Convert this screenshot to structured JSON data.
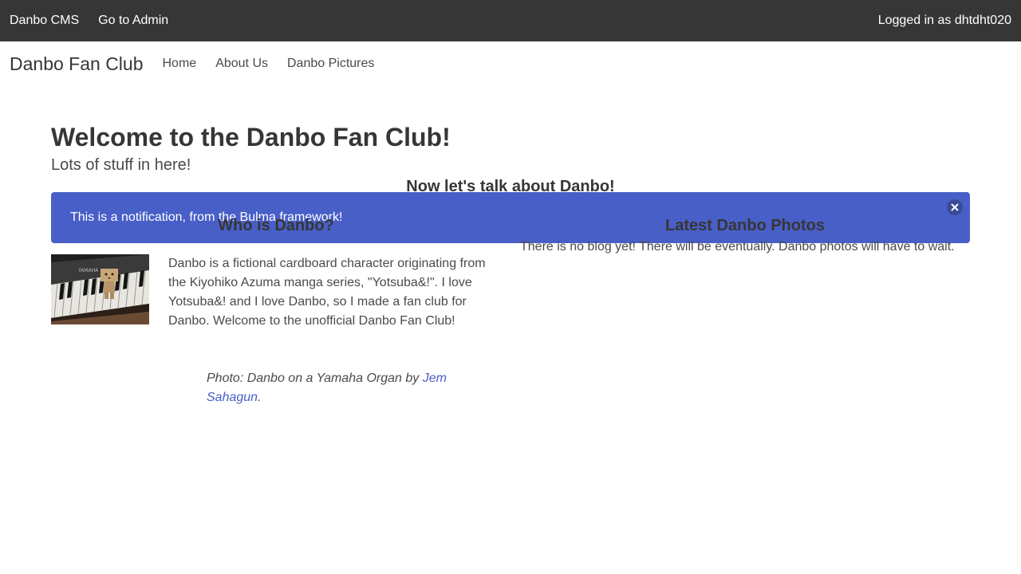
{
  "adminbar": {
    "cms_label": "Danbo CMS",
    "admin_link": "Go to Admin",
    "logged_in": "Logged in as dhtdht020"
  },
  "nav": {
    "brand": "Danbo Fan Club",
    "links": [
      "Home",
      "About Us",
      "Danbo Pictures"
    ]
  },
  "hero": {
    "title": "Welcome to the Danbo Fan Club!",
    "subtitle": "Lots of stuff in here!"
  },
  "notification": {
    "text": "This is a notification, from the Bulma framework!",
    "color": "#485fc7"
  },
  "section": {
    "title": "Now let's talk about Danbo!"
  },
  "left_column": {
    "title": "Who is Danbo?",
    "text": "Danbo is a fictional cardboard character originating from the Kiyohiko Azuma manga series, \"Yotsuba&!\". I love Yotsuba&! and I love Danbo, so I made a fan club for Danbo. Welcome to the unofficial Danbo Fan Club!",
    "caption_prefix": "Photo: Danbo on a Yamaha Organ by ",
    "caption_link": "Jem Sahagun",
    "caption_suffix": "."
  },
  "right_column": {
    "title": "Latest Danbo Photos",
    "text": "There is no blog yet! There will be eventually. Danbo photos will have to wait."
  },
  "icons": {
    "close": "close-icon"
  },
  "colors": {
    "adminbar": "#363636",
    "link": "#485fc7"
  }
}
